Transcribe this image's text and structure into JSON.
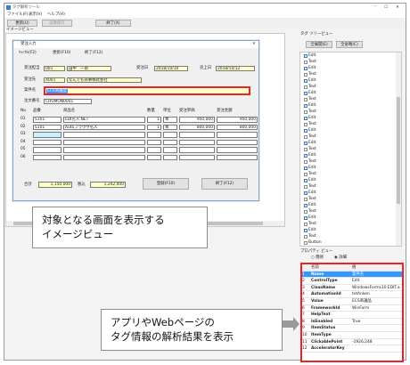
{
  "window": {
    "title": "タグ解析ツール"
  },
  "menu": [
    "ファイル(F)",
    "表示(V)",
    "ヘルプ(H)"
  ],
  "toolbar": {
    "update": "更新(U)",
    "snapshot": "画像保存",
    "close": "終了(X)"
  },
  "image_view_label": "イメージビュー",
  "tree_label": "タグ ツリービュー",
  "tree_buttons": {
    "expand": "全展開(E)",
    "collapse": "全省略(C)"
  },
  "tree_items": [
    "Edit",
    "Text",
    "Edit",
    "Text",
    "Edit",
    "Text",
    "Edit",
    "Text",
    "Edit",
    "Text",
    "Edit",
    "Text",
    "Edit",
    "Text",
    "Edit",
    "Text",
    "Edit",
    "Text",
    "Edit",
    "Text",
    "Edit",
    "Text",
    "Edit",
    "Text",
    "Edit",
    "Text",
    "Edit",
    "Text",
    "Edit",
    "Text",
    "Button",
    "Button",
    "Text",
    "Text",
    "MenuBar",
    "TitleBar",
    "TitleBar"
  ],
  "props_label": "プロパティ ビュー",
  "props_radio": {
    "simple": "簡易",
    "detail": "詳細"
  },
  "props_header": {
    "name": "名前",
    "value": "値"
  },
  "props_rows": [
    {
      "no": "1",
      "name": "Name",
      "value": "案件名"
    },
    {
      "no": "2",
      "name": "ControlType",
      "value": "Edit"
    },
    {
      "no": "3",
      "name": "ClassName",
      "value": "WindowsForms10.EDIT.app"
    },
    {
      "no": "4",
      "name": "AutomationId",
      "value": "txtAnken"
    },
    {
      "no": "5",
      "name": "Value",
      "value": "ECS商議品"
    },
    {
      "no": "6",
      "name": "FrameworkId",
      "value": "WinForm"
    },
    {
      "no": "7",
      "name": "HelpText",
      "value": ""
    },
    {
      "no": "8",
      "name": "IsEnabled",
      "value": "True"
    },
    {
      "no": "9",
      "name": "ItemStatus",
      "value": ""
    },
    {
      "no": "10",
      "name": "ItemType",
      "value": ""
    },
    {
      "no": "11",
      "name": "ClickablePoint",
      "value": "-1926,248"
    },
    {
      "no": "12",
      "name": "AcceleratorKey",
      "value": ""
    }
  ],
  "form": {
    "title": "受注入力",
    "tab_close": "ｷｬﾝｾﾙ(F2)",
    "tab_update": "更新(F10)",
    "tab_exit": "終了(F12)",
    "order_no_label": "受注担当",
    "order_no": "001",
    "person": "田中　一郎",
    "order_date_label": "受注日",
    "order_date": "2018/10/10",
    "sales_date_label": "売上日",
    "sales_date": "2018/10/12",
    "customer_label": "受注先",
    "customer_code": "A001",
    "customer_name": "なんでも商事株式会社",
    "project_label": "案件名",
    "project_value": "ECS商議品",
    "note_label": "注文番号",
    "note_value": "CHUMON0001",
    "grid_headers": [
      "No",
      "品番",
      "商品名",
      "数量",
      "単位",
      "受注単価",
      "受注金額"
    ],
    "grid_rows": [
      {
        "no": "01",
        "code": "S101",
        "name": "EDI名人.NET",
        "qty": "1",
        "unit": "本",
        "price": "950,000",
        "amount": "950,000"
      },
      {
        "no": "02",
        "code": "S101",
        "name": "Autoブラウザ名人",
        "qty": "1",
        "unit": "本",
        "price": "800,000",
        "amount": "800,000"
      },
      {
        "no": "03",
        "code": "",
        "name": "",
        "qty": "",
        "unit": "",
        "price": "",
        "amount": ""
      },
      {
        "no": "04",
        "code": "",
        "name": "",
        "qty": "",
        "unit": "",
        "price": "",
        "amount": ""
      },
      {
        "no": "05",
        "code": "",
        "name": "",
        "qty": "",
        "unit": "",
        "price": "",
        "amount": ""
      },
      {
        "no": "06",
        "code": "",
        "name": "",
        "qty": "",
        "unit": "",
        "price": "",
        "amount": ""
      }
    ],
    "total_label": "合計",
    "total": "1,150,000",
    "tax_label": "税込",
    "tax_total": "1,242,000",
    "register_btn": "登録(F10)",
    "exit_btn": "終了(F12)"
  },
  "callouts": {
    "image_view": [
      "対象となる画面を表示する",
      "イメージビュー"
    ],
    "props": [
      "アプリやWebページの",
      "タグ情報の解析結果を表示"
    ]
  },
  "colors": {
    "highlight": "#e8232a",
    "selected": "#3399ff",
    "field_yellow": "#ffffc6"
  }
}
